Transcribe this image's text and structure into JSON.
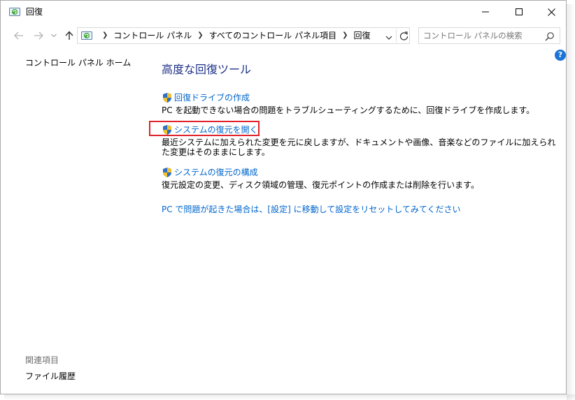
{
  "window": {
    "title": "回復"
  },
  "address_bar": {
    "breadcrumbs": [
      "コントロール パネル",
      "すべてのコントロール パネル項目",
      "回復"
    ]
  },
  "search": {
    "placeholder": "コントロール パネルの検索"
  },
  "help": {
    "label": "?"
  },
  "sidebar": {
    "home_link": "コントロール パネル ホーム",
    "related_title": "関連項目",
    "related_items": [
      "ファイル履歴"
    ]
  },
  "main": {
    "title": "高度な回復ツール",
    "tasks": [
      {
        "link": "回復ドライブの作成",
        "description": "PC を起動できない場合の問題をトラブルシューティングするために、回復ドライブを作成します。"
      },
      {
        "link": "システムの復元を開く",
        "description": "最近システムに加えられた変更を元に戻しますが、ドキュメントや画像、音楽などのファイルに加えられた変更はそのままにします。"
      },
      {
        "link": "システムの復元の構成",
        "description": "復元設定の変更、ディスク領域の管理、復元ポイントの作成または削除を行います。"
      }
    ],
    "reset_link": "PC で問題が起きた場合は、[設定] に移動して設定をリセットしてみてください"
  },
  "icons": {
    "app": "recovery-icon",
    "shield": "uac-shield-icon"
  },
  "colors": {
    "link": "#0066cc",
    "title": "#1e3287",
    "highlight": "#e0222a",
    "muted": "#6d6d6d"
  }
}
